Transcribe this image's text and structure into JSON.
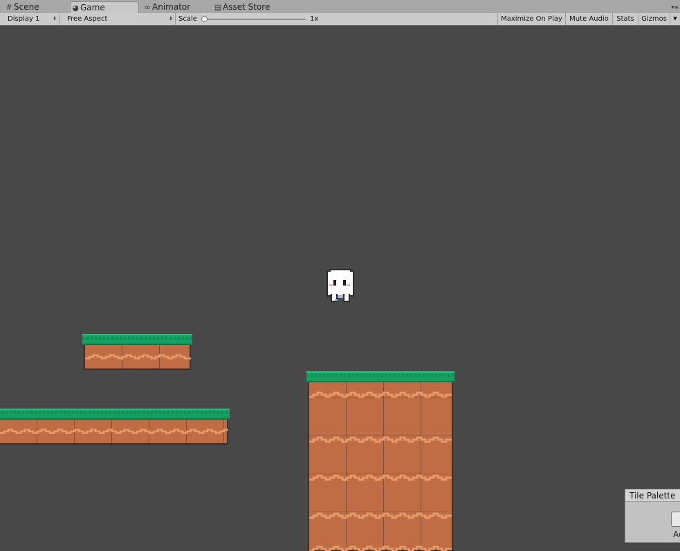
{
  "tabs": [
    {
      "label": "Scene",
      "icon": "grid-icon"
    },
    {
      "label": "Game",
      "icon": "pacman-icon",
      "active": true
    },
    {
      "label": "Animator",
      "icon": "animator-icon"
    },
    {
      "label": "Asset Store",
      "icon": "store-icon"
    }
  ],
  "toolbar": {
    "display": "Display 1",
    "aspect": "Free Aspect",
    "scale_label": "Scale",
    "scale_value": "1x",
    "maximize_on_play": "Maximize On Play",
    "mute_audio": "Mute Audio",
    "stats": "Stats",
    "gizmos": "Gizmos"
  },
  "tile_palette": {
    "title": "Tile Palette",
    "sub": "Ac"
  },
  "colors": {
    "viewport_bg": "#484848",
    "grass": "#15a063",
    "dirt": "#c06d45",
    "dirt_wave": "#e09a68"
  }
}
